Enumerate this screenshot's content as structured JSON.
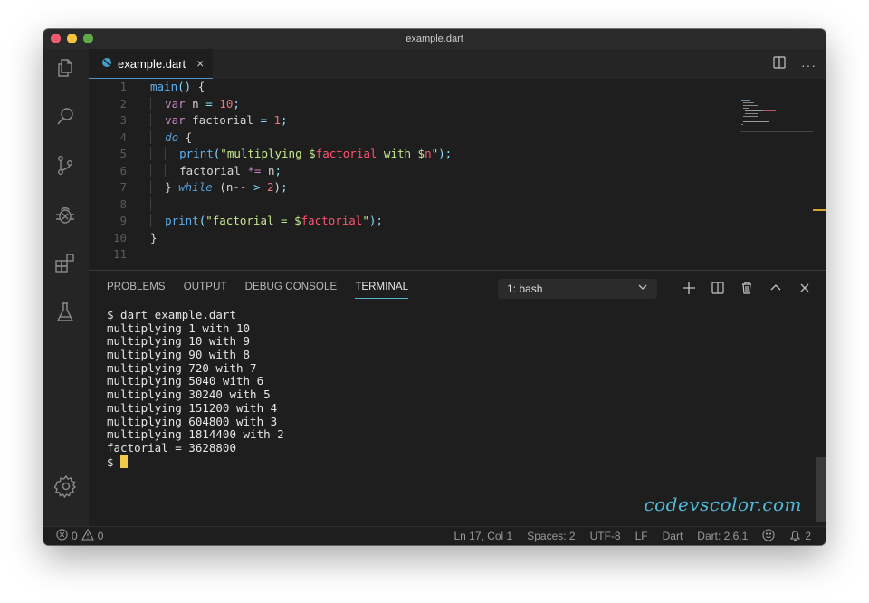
{
  "window": {
    "title": "example.dart",
    "traffic_lights": {
      "close": "#ee5a6f",
      "minimize": "#f5c242",
      "maximize": "#5fa84a"
    }
  },
  "activity_bar": {
    "items": [
      {
        "name": "explorer",
        "icon": "files-icon"
      },
      {
        "name": "search",
        "icon": "search-icon"
      },
      {
        "name": "source-control",
        "icon": "source-control-icon"
      },
      {
        "name": "debug",
        "icon": "debug-icon"
      },
      {
        "name": "extensions",
        "icon": "extensions-icon"
      },
      {
        "name": "testing",
        "icon": "flask-icon"
      }
    ],
    "bottom": {
      "name": "manage",
      "icon": "gear-icon"
    }
  },
  "editor": {
    "tab": {
      "label": "example.dart",
      "close": "×",
      "icon": "dart-icon"
    },
    "actions": {
      "split": "split-editor-icon",
      "more": "···"
    },
    "line_numbers": [
      "1",
      "2",
      "3",
      "4",
      "5",
      "6",
      "7",
      "8",
      "9",
      "10",
      "11"
    ],
    "code_lines": [
      "main() {",
      "  var n = 10;",
      "  var factorial = 1;",
      "  do {",
      "    print(\"multiplying $factorial with $n\");",
      "    factorial *= n;",
      "  } while (n-- > 2);",
      "",
      "  print(\"factorial = $factorial\");",
      "}",
      ""
    ]
  },
  "panel": {
    "tabs": [
      {
        "label": "PROBLEMS",
        "active": false
      },
      {
        "label": "OUTPUT",
        "active": false
      },
      {
        "label": "DEBUG CONSOLE",
        "active": false
      },
      {
        "label": "TERMINAL",
        "active": true
      }
    ],
    "terminal_select": "1: bash",
    "actions": [
      "new-terminal",
      "split-terminal",
      "kill-terminal",
      "maximize-panel",
      "close-panel"
    ],
    "terminal_lines": [
      "$ dart example.dart",
      "multiplying 1 with 10",
      "multiplying 10 with 9",
      "multiplying 90 with 8",
      "multiplying 720 with 7",
      "multiplying 5040 with 6",
      "multiplying 30240 with 5",
      "multiplying 151200 with 4",
      "multiplying 604800 with 3",
      "multiplying 1814400 with 2",
      "factorial = 3628800"
    ],
    "prompt": "$ "
  },
  "watermark": "codevscolor.com",
  "statusbar": {
    "errors": "0",
    "warnings": "0",
    "position": "Ln 17, Col 1",
    "spaces": "Spaces: 2",
    "encoding": "UTF-8",
    "eol": "LF",
    "language": "Dart",
    "sdk": "Dart: 2.6.1",
    "notifications": "2"
  }
}
